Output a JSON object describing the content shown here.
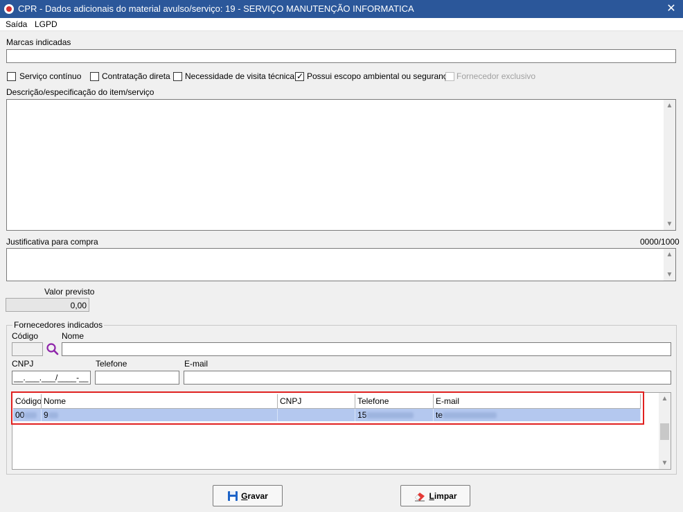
{
  "window": {
    "title": "CPR - Dados adicionais do material avulso/serviço: 19 - SERVIÇO MANUTENÇÃO INFORMATICA",
    "close_glyph": "✕"
  },
  "menu": [
    "Saída",
    "LGPD"
  ],
  "marcas": {
    "label": "Marcas indicadas",
    "value": ""
  },
  "checkboxes": [
    {
      "label": "Serviço contínuo",
      "checked": false,
      "enabled": true
    },
    {
      "label": "Contratação direta",
      "checked": false,
      "enabled": true
    },
    {
      "label": "Necessidade de visita técnica",
      "checked": false,
      "enabled": true
    },
    {
      "label": "Possui escopo ambiental ou segurança",
      "checked": true,
      "enabled": true
    },
    {
      "label": "Fornecedor exclusivo",
      "checked": false,
      "enabled": false
    }
  ],
  "descricao": {
    "label": "Descrição/especificação do item/serviço",
    "value": ""
  },
  "justificativa": {
    "label": "Justificativa para compra",
    "counter": "0000/1000",
    "value": ""
  },
  "valor": {
    "label": "Valor previsto",
    "value": "0,00"
  },
  "fornecedores": {
    "legend": "Fornecedores indicados",
    "codigo_label": "Código",
    "codigo_value": "",
    "nome_label": "Nome",
    "cnpj_label": "CNPJ",
    "cnpj_mask": "__.___.___/____-__",
    "telefone_label": "Telefone",
    "email_label": "E-mail",
    "grid": {
      "columns": [
        "Código",
        "Nome",
        "CNPJ",
        "Telefone",
        "E-mail"
      ],
      "rows": [
        {
          "codigo": "00",
          "nome": "9",
          "cnpj": "",
          "telefone": "15",
          "email": "te"
        }
      ]
    }
  },
  "buttons": {
    "gravar": {
      "underline": "G",
      "rest": "ravar"
    },
    "limpar": {
      "underline": "L",
      "rest": "impar"
    }
  },
  "colors": {
    "titlebar": "#2b579a",
    "selection": "#b4c8ef",
    "highlight": "#e0201f"
  }
}
